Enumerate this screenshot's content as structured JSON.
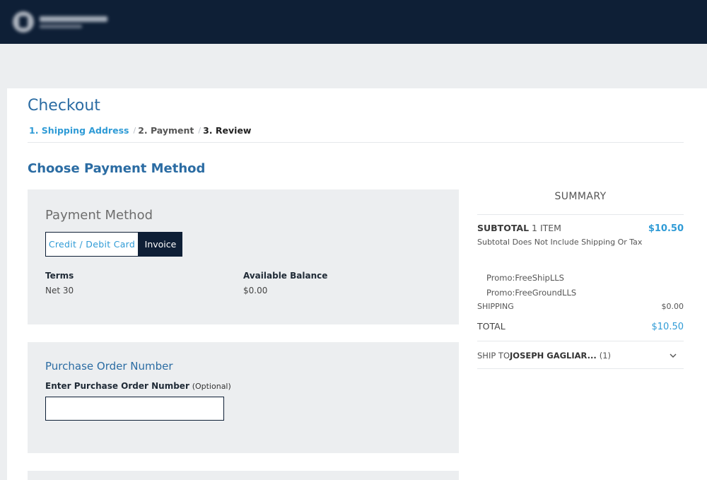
{
  "header": {
    "logo_text": "Logo"
  },
  "checkout": {
    "title": "Checkout",
    "steps": {
      "step1": "1. Shipping Address",
      "separator": "/",
      "step2": "2. Payment",
      "step3": "3. Review"
    },
    "section_title": "Choose Payment Method"
  },
  "payment": {
    "heading": "Payment Method",
    "tabs": {
      "card": "Credit / Debit Card",
      "invoice": "Invoice",
      "selected": "Invoice"
    },
    "terms_label": "Terms",
    "terms_value": "Net 30",
    "balance_label": "Available Balance",
    "balance_value": "$0.00"
  },
  "purchase_order": {
    "heading": "Purchase Order Number",
    "label": "Enter Purchase Order Number",
    "optional": "(Optional)",
    "value": "",
    "placeholder": ""
  },
  "summary": {
    "title": "SUMMARY",
    "subtotal_label": "SUBTOTAL",
    "subtotal_items": "1 ITEM",
    "subtotal_value": "$10.50",
    "subtotal_note": "Subtotal Does Not Include Shipping Or Tax",
    "promos": [
      "Promo:FreeShipLLS",
      "Promo:FreeGroundLLS"
    ],
    "shipping_label": "SHIPPING",
    "shipping_value": "$0.00",
    "total_label": "TOTAL",
    "total_value": "$10.50",
    "ship_to_prefix": "SHIP TO",
    "ship_to_name": "JOSEPH GAGLIAR...",
    "ship_to_count": "(1)"
  },
  "colors": {
    "header_bg": "#0e1f36",
    "accent_blue": "#2f9bd6",
    "heading_blue": "#2b6ca3",
    "panel_bg": "#eceef0"
  }
}
